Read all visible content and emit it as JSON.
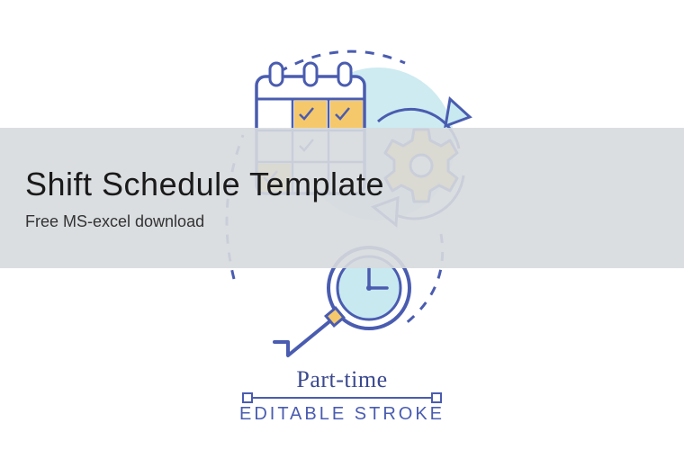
{
  "overlay": {
    "title": "Shift Schedule Template",
    "subtitle": "Free MS-excel download"
  },
  "illustration": {
    "label_top": "Part-time",
    "label_bottom": "EDITABLE STROKE",
    "colors": {
      "primary_stroke": "#4a5cb0",
      "accent_fill": "#f5c96b",
      "background_circle": "#c8e9f0",
      "white": "#ffffff"
    }
  }
}
